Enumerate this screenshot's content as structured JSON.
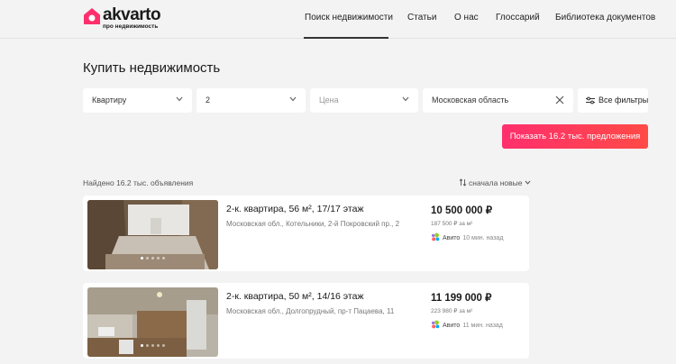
{
  "header": {
    "logo_word": "akvarto",
    "logo_sub": "про недвижимость",
    "nav": [
      "Поиск недвижимости",
      "Статьи",
      "О нас",
      "Глоссарий",
      "Библиотека документов"
    ]
  },
  "page_title": "Купить недвижимость",
  "filters": {
    "type": "Квартиру",
    "rooms": "2",
    "price_placeholder": "Цена",
    "region": "Московская область",
    "all_filters": "Все фильтры"
  },
  "show_button": "Показать 16.2 тыс. предложения",
  "results": {
    "found": "Найдено 16.2 тыс. объявления",
    "sort": "сначала новые"
  },
  "listings": [
    {
      "title": "2-к. квартира, 56 м², 17/17 этаж",
      "address": "Московская обл., Котельники, 2-й Покровский пр., 2",
      "price": "10 500 000 ₽",
      "price_per_m2": "187 500 ₽ за м²",
      "source": "Авито",
      "time": "10 мин. назад"
    },
    {
      "title": "2-к. квартира, 50 м², 14/16 этаж",
      "address": "Московская обл., Долгопрудный, пр-т Пацаева, 11",
      "price": "11 199 000 ₽",
      "price_per_m2": "223 980 ₽ за м²",
      "source": "Авито",
      "time": "11 мин. назад"
    }
  ],
  "colors": {
    "accent": "#ff2f6d",
    "accent_end": "#ff4a46",
    "background": "#f3f3f3"
  },
  "icons": [
    "home-logo-icon",
    "chevron-down-icon",
    "close-icon",
    "filter-icon",
    "sort-icon",
    "avito-icon"
  ]
}
